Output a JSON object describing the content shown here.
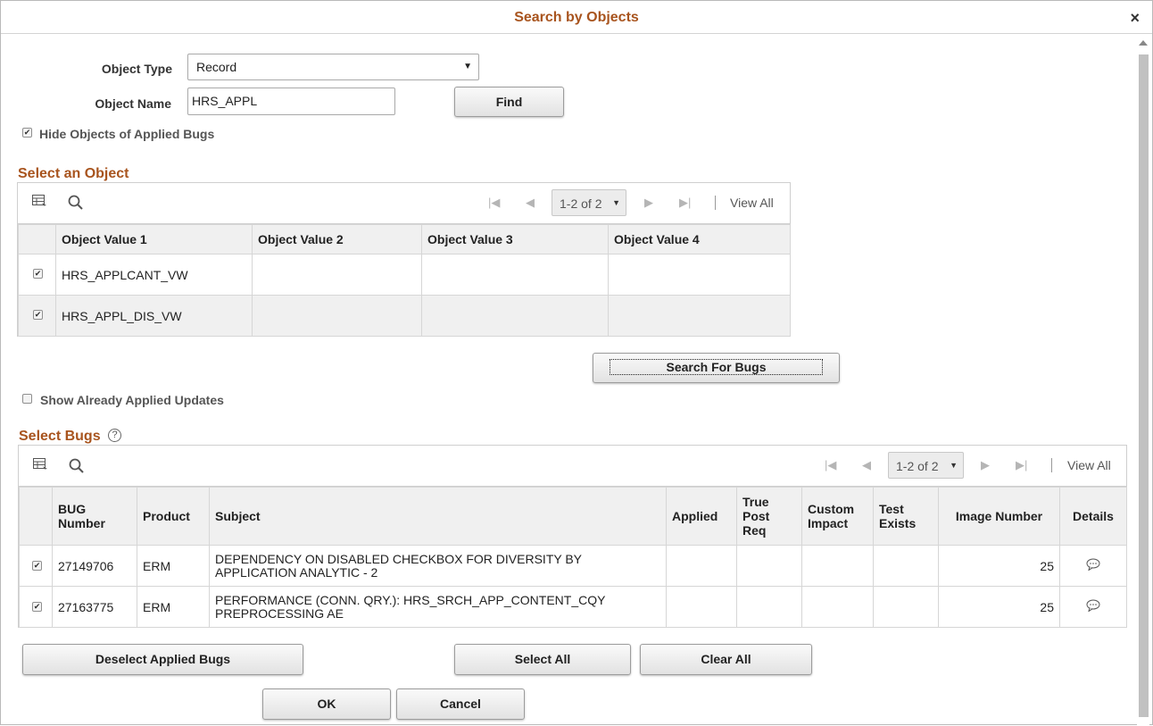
{
  "dialog": {
    "title": "Search by Objects",
    "close_glyph": "×"
  },
  "form": {
    "object_type_label": "Object Type",
    "object_type_value": "Record",
    "object_name_label": "Object Name",
    "object_name_value": "HRS_APPL",
    "find_label": "Find",
    "hide_applied_label": "Hide Objects of Applied Bugs",
    "hide_applied_checked": true
  },
  "objects_section": {
    "title": "Select an Object",
    "pager": "1-2 of 2",
    "view_all": "View All",
    "columns": [
      "Object Value 1",
      "Object Value 2",
      "Object Value 3",
      "Object Value 4"
    ],
    "rows": [
      {
        "checked": true,
        "values": [
          "HRS_APPLCANT_VW",
          "",
          "",
          ""
        ]
      },
      {
        "checked": true,
        "values": [
          "HRS_APPL_DIS_VW",
          "",
          "",
          ""
        ]
      }
    ]
  },
  "search_bugs_label": "Search For Bugs",
  "show_applied_label": "Show Already Applied Updates",
  "show_applied_checked": false,
  "bugs_section": {
    "title": "Select Bugs",
    "help_glyph": "?",
    "pager": "1-2 of 2",
    "view_all": "View All",
    "columns": {
      "bug_number_l1": "BUG",
      "bug_number_l2": "Number",
      "product": "Product",
      "subject": "Subject",
      "applied": "Applied",
      "true_post_l1": "True",
      "true_post_l2": "Post",
      "true_post_l3": "Req",
      "custom_l1": "Custom",
      "custom_l2": "Impact",
      "test_l1": "Test",
      "test_l2": "Exists",
      "image_number": "Image Number",
      "details": "Details"
    },
    "rows": [
      {
        "checked": true,
        "bug": "27149706",
        "product": "ERM",
        "subject_l1": "DEPENDENCY ON DISABLED CHECKBOX FOR DIVERSITY  BY",
        "subject_l2": "APPLICATION ANALYTIC - 2",
        "applied": "",
        "true_post": "",
        "custom": "",
        "test": "",
        "image": "25"
      },
      {
        "checked": true,
        "bug": "27163775",
        "product": "ERM",
        "subject_l1": "PERFORMANCE (CONN. QRY.):  HRS_SRCH_APP_CONTENT_CQY",
        "subject_l2": "PREPROCESSING AE",
        "applied": "",
        "true_post": "",
        "custom": "",
        "test": "",
        "image": "25"
      }
    ]
  },
  "buttons": {
    "deselect_applied": "Deselect Applied Bugs",
    "select_all": "Select All",
    "clear_all": "Clear All",
    "ok": "OK",
    "cancel": "Cancel"
  },
  "colors": {
    "accent": "#a8541e",
    "header_bg": "#f0f0f0"
  }
}
